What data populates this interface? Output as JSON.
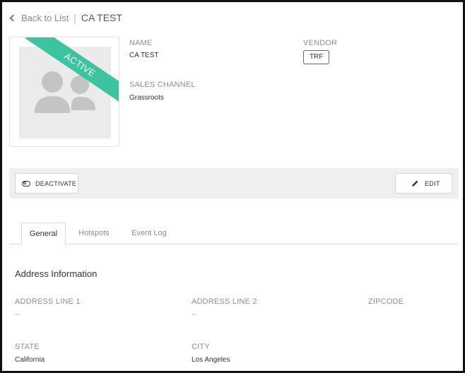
{
  "header": {
    "back_label": "Back to List",
    "title": "CA TEST"
  },
  "profile": {
    "status_ribbon": "ACTIVE",
    "name_label": "NAME",
    "name_value": "CA TEST",
    "vendor_label": "VENDOR",
    "vendor_value": "TRF",
    "sales_channel_label": "SALES CHANNEL",
    "sales_channel_value": "Grassroots",
    "accent_color": "#3cc4a0"
  },
  "actions": {
    "deactivate_label": "DEACTIVATE",
    "edit_label": "EDIT"
  },
  "tabs": [
    {
      "label": "General",
      "active": true
    },
    {
      "label": "Hotspots",
      "active": false
    },
    {
      "label": "Event Log",
      "active": false
    }
  ],
  "address": {
    "section_title": "Address Information",
    "line1_label": "ADDRESS LINE 1",
    "line1_value": "--",
    "line2_label": "ADDRESS LINE 2",
    "line2_value": "--",
    "zipcode_label": "ZIPCODE",
    "state_label": "STATE",
    "state_value": "California",
    "city_label": "CITY",
    "city_value": "Los Angeles"
  }
}
